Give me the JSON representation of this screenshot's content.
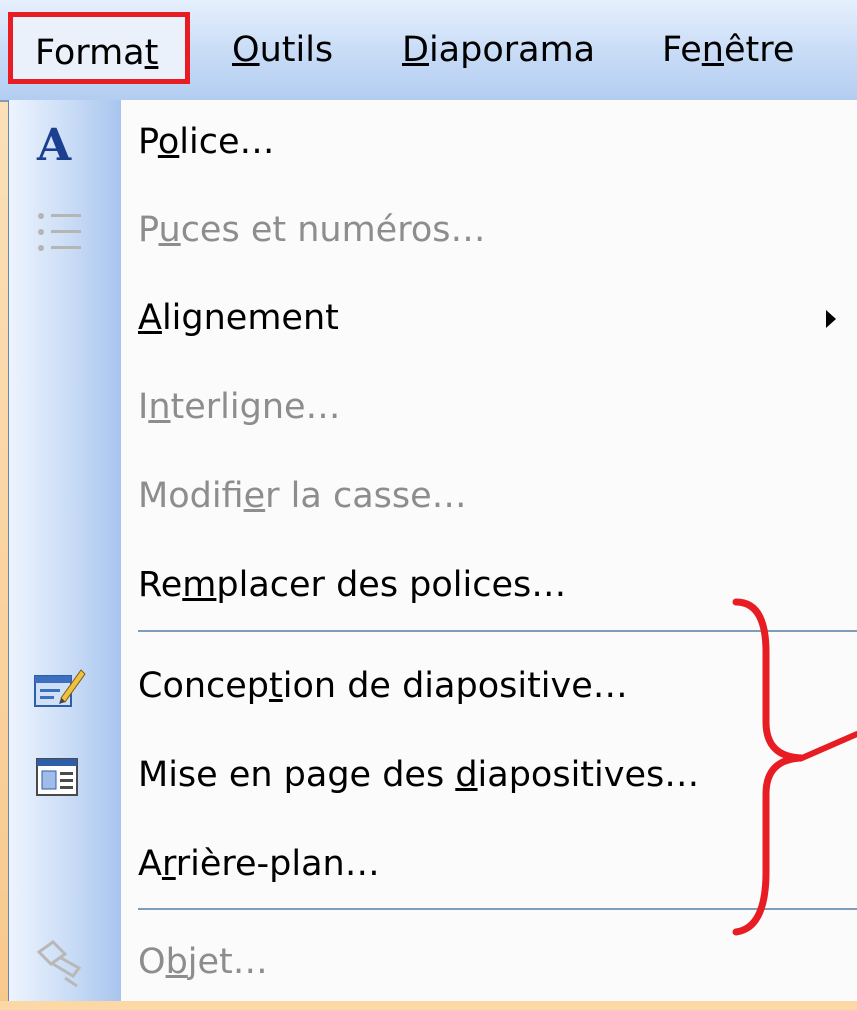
{
  "menubar": {
    "items": [
      {
        "pre": "Forma",
        "mn": "t",
        "post": ""
      },
      {
        "pre": "",
        "mn": "O",
        "post": "utils"
      },
      {
        "pre": "",
        "mn": "D",
        "post": "iaporama"
      },
      {
        "pre": "Fe",
        "mn": "n",
        "post": "être"
      }
    ]
  },
  "menu": {
    "items": [
      {
        "pre": "P",
        "mn": "o",
        "post": "lice…",
        "icon": "font-a-icon",
        "disabled": false
      },
      {
        "pre": "P",
        "mn": "u",
        "post": "ces et numéros…",
        "icon": "bullets-numbering-icon",
        "disabled": true
      },
      {
        "pre": "",
        "mn": "A",
        "post": "lignement",
        "icon": "",
        "disabled": false,
        "submenu": true
      },
      {
        "pre": "I",
        "mn": "n",
        "post": "terligne…",
        "icon": "",
        "disabled": true
      },
      {
        "pre": "Modifi",
        "mn": "e",
        "post": "r la casse…",
        "icon": "",
        "disabled": true
      },
      {
        "pre": "Re",
        "mn": "m",
        "post": "placer des polices…",
        "icon": "",
        "disabled": false
      },
      {
        "pre": "Concep",
        "mn": "t",
        "post": "ion de diapositive…",
        "icon": "slide-design-icon",
        "disabled": false
      },
      {
        "pre": "Mise en page des ",
        "mn": "d",
        "post": "iapositives…",
        "icon": "slide-layout-icon",
        "disabled": false
      },
      {
        "pre": "A",
        "mn": "r",
        "post": "rière-plan…",
        "icon": "",
        "disabled": false
      },
      {
        "pre": "O",
        "mn": "b",
        "post": "jet…",
        "icon": "object-icon",
        "disabled": true
      }
    ]
  },
  "colors": {
    "highlight_border": "#e81d23",
    "brace": "#e81d23",
    "separator": "#7f9db9"
  }
}
